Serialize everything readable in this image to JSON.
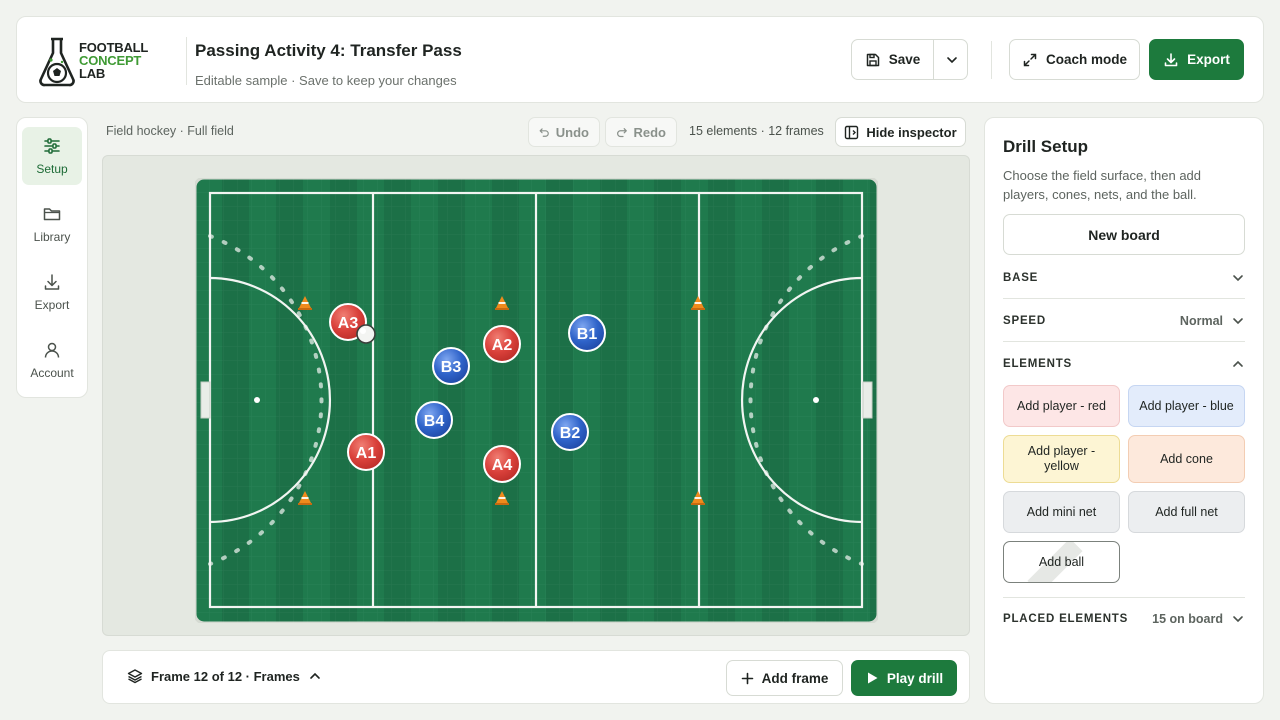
{
  "brand": {
    "line1": "FOOTBALL",
    "line2": "CONCEPT",
    "line3": "LAB",
    "green": "#3f9a34"
  },
  "header": {
    "title": "Passing Activity 4: Transfer Pass",
    "subtitle": "Editable sample · Save to keep your changes",
    "save_label": "Save",
    "coach_label": "Coach mode",
    "export_label": "Export"
  },
  "nav": {
    "items": [
      {
        "label": "Setup",
        "icon": "sliders-icon",
        "active": true
      },
      {
        "label": "Library",
        "icon": "folder-icon"
      },
      {
        "label": "Export",
        "icon": "download-icon"
      },
      {
        "label": "Account",
        "icon": "user-icon"
      }
    ]
  },
  "toolbar": {
    "breadcrumb": "Field hockey · Full field",
    "undo_label": "Undo",
    "redo_label": "Redo",
    "counts": "15 elements · 12 frames",
    "hide_inspector_label": "Hide inspector"
  },
  "board": {
    "surface_color": "#1f7a4d",
    "players": [
      {
        "label": "A3",
        "team": "red"
      },
      {
        "label": "A2",
        "team": "red"
      },
      {
        "label": "A1",
        "team": "red"
      },
      {
        "label": "A4",
        "team": "red"
      },
      {
        "label": "B1",
        "team": "blue"
      },
      {
        "label": "B3",
        "team": "blue"
      },
      {
        "label": "B4",
        "team": "blue"
      },
      {
        "label": "B2",
        "team": "blue"
      }
    ],
    "cone_count": 6,
    "ball_count": 1
  },
  "bottom": {
    "frames_label": "Frame 12 of 12 · Frames",
    "add_frame_label": "Add frame",
    "play_label": "Play drill"
  },
  "inspector": {
    "title": "Drill Setup",
    "description": "Choose the field surface, then add players, cones, nets, and the ball.",
    "new_board_label": "New board",
    "base_label": "BASE",
    "speed_label": "SPEED",
    "speed_value": "Normal",
    "elements_label": "ELEMENTS",
    "add_red": "Add player - red",
    "add_blue": "Add player - blue",
    "add_yellow": "Add player - yellow",
    "add_cone": "Add cone",
    "add_mini_net": "Add mini net",
    "add_full_net": "Add full net",
    "add_ball": "Add ball",
    "placed_label": "PLACED ELEMENTS",
    "placed_value": "15 on board"
  },
  "colors": {
    "accent": "#1d7a3d",
    "red_player": "#d9403a",
    "blue_player": "#2f63c9",
    "cone": "#f08a1c"
  }
}
